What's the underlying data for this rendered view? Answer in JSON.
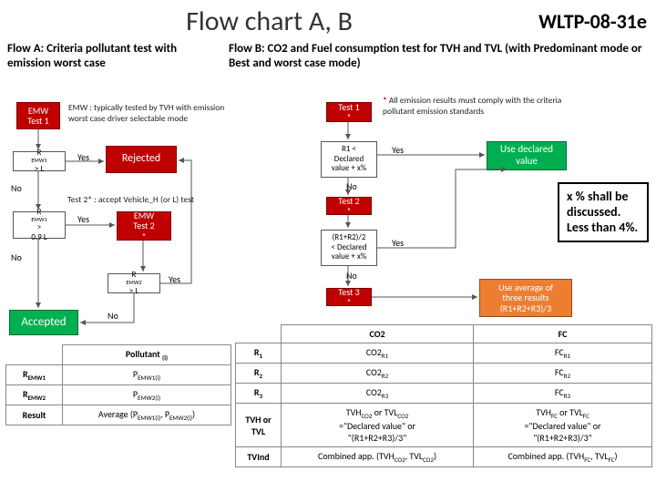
{
  "header": {
    "title": "Flow chart A, B",
    "docid": "WLTP-08-31e"
  },
  "flowA": {
    "subtitle": "Flow A: Criteria pollutant test with emission worst case",
    "emw_test1": "EMW\nTest 1",
    "emw_note": "EMW : typically tested by TVH with emission worst case driver selectable mode",
    "dec1": "R_EMW1 > L",
    "rejected": "Rejected",
    "no1": "No",
    "yes1": "Yes",
    "test2_note": "Test 2* : accept Vehicle_H (or L) test",
    "dec2": "R_EMW1 >\n0.9 L",
    "yes2": "Yes",
    "emw_test2": "EMW\nTest 2 *",
    "no2": "No",
    "dec3": "R_EMW2 > L",
    "yes3": "Yes",
    "no3": "No",
    "accepted": "Accepted",
    "table": {
      "h2": "Pollutant (i)",
      "r1c1": "R_EMW1",
      "r1c2": "P_EMW1(i)",
      "r2c1": "R_EMW2",
      "r2c2": "P_EMW2(i)",
      "r3c1": "Result",
      "r3c2": "Average (P_EMW1(i), P_EMW2(i))"
    }
  },
  "flowB": {
    "subtitle": "Flow B: CO2 and Fuel consumption test for TVH and TVL (with Predominant mode or Best and worst case mode)",
    "test1": "Test 1*",
    "star_note": "* All emission results must comply with the criteria pollutant emission standards",
    "dec1": "R1 <\nDeclared\nvalue + x%",
    "yes1": "Yes",
    "no1": "No",
    "use_declared": "Use declared\nvalue",
    "test2": "Test 2*",
    "dec2": "(R1+R2)/2\n< Declared\nvalue + x%",
    "yes2": "Yes",
    "no2": "No",
    "test3": "Test 3*",
    "use_avg": "Use average of\nthree results\n(R1+R2+R3)/3",
    "callout": "x % shall be discussed. Less than 4%.",
    "table": {
      "h2": "CO2",
      "h3": "FC",
      "r1c1": "R1",
      "r1c2": "CO2_R1",
      "r1c3": "FC_R1",
      "r2c1": "R2",
      "r2c2": "CO2_R2",
      "r2c3": "FC_R2",
      "r3c1": "R3",
      "r3c2": "CO2_R3",
      "r3c3": "FC_R3",
      "r4c1": "TVH or TVL",
      "r4c2": "TVH_CO2 or TVL_CO2\n=\"Declared value\" or\n\"(R1+R2+R3)/3\"",
      "r4c3": "TVH_FC or TVL_FC\n=\"Declared value\" or\n\"(R1+R2+R3)/3\"",
      "r5c1": "TVInd",
      "r5c2": "Combined app. (TVH_CO2, TVL_CO2)",
      "r5c3": "Combined app. (TVH_FC, TVL_FC)"
    }
  }
}
